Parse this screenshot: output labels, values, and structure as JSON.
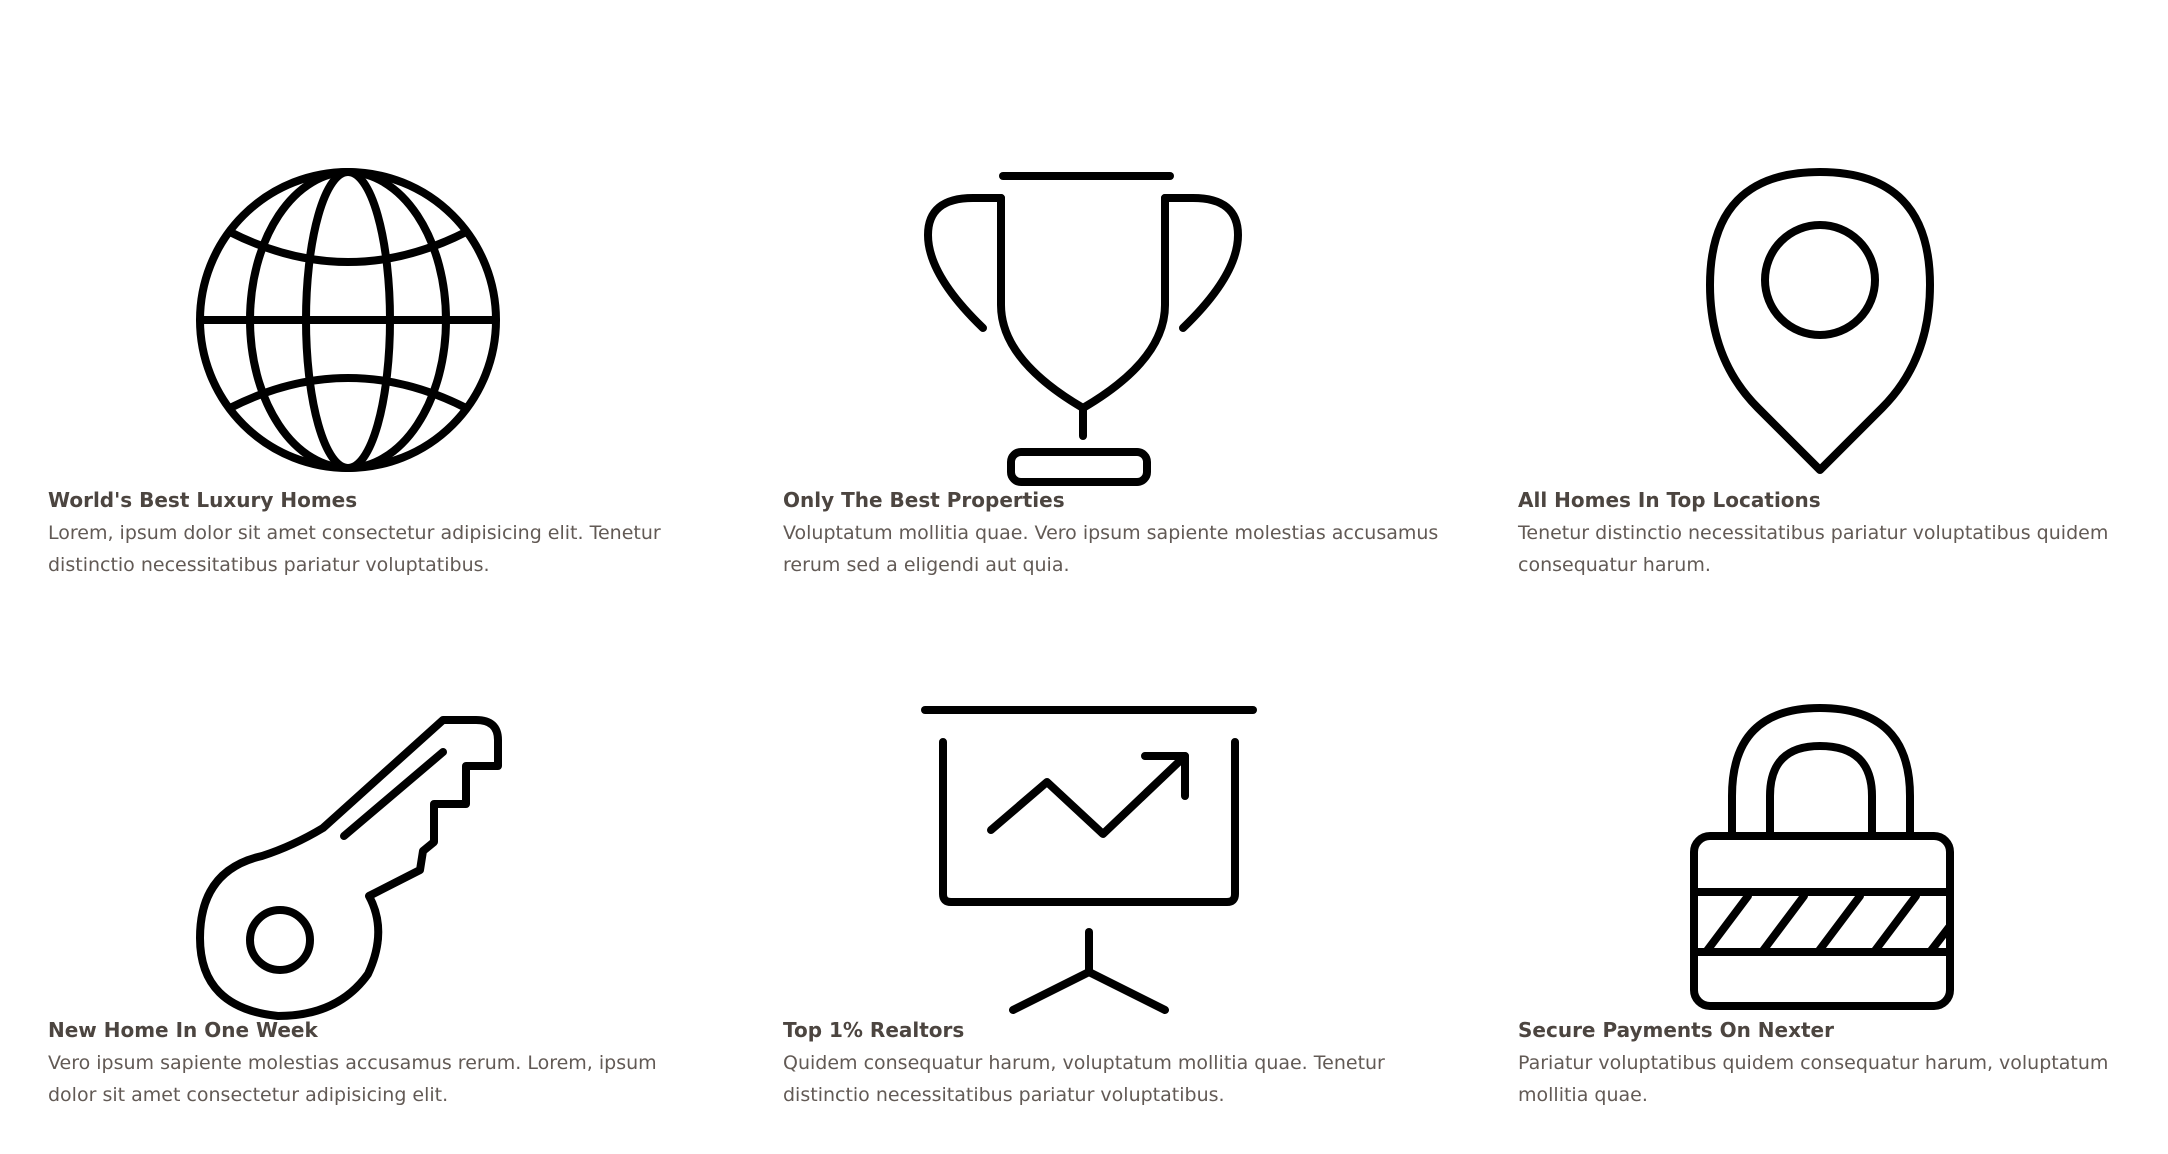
{
  "features": [
    {
      "icon": "globe-icon",
      "title": "World's Best Luxury Homes",
      "text": "Lorem, ipsum dolor sit amet consectetur adipisicing elit. Tenetur distinctio necessitatibus pariatur voluptatibus."
    },
    {
      "icon": "trophy-icon",
      "title": "Only The Best Properties",
      "text": "Voluptatum mollitia quae. Vero ipsum sapiente molestias accusamus rerum sed a eligendi aut quia."
    },
    {
      "icon": "map-pin-icon",
      "title": "All Homes In Top Locations",
      "text": "Tenetur distinctio necessitatibus pariatur voluptatibus quidem consequatur harum."
    },
    {
      "icon": "key-icon",
      "title": "New Home In One Week",
      "text": "Vero ipsum sapiente molestias accusamus rerum. Lorem, ipsum dolor sit amet consectetur adipisicing elit."
    },
    {
      "icon": "presentation-chart-icon",
      "title": "Top 1% Realtors",
      "text": "Quidem consequatur harum, voluptatum mollitia quae. Tenetur distinctio necessitatibus pariatur voluptatibus."
    },
    {
      "icon": "lock-icon",
      "title": "Secure Payments On Nexter",
      "text": "Pariatur voluptatibus quidem consequatur harum, voluptatum mollitia quae."
    }
  ]
}
